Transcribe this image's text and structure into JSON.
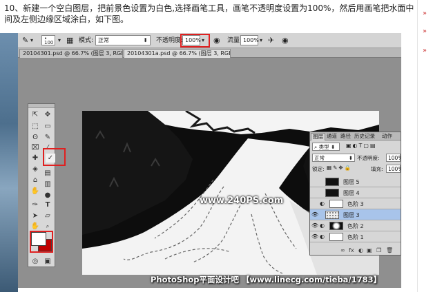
{
  "instruction": "10、新建一个空白图层，把前景色设置为白色,选择画笔工具，画笔不透明度设置为100%，然后用画笔把水面中间及左侧边缘区域涂白，如下图。",
  "colors": {
    "accent": "#e02020",
    "foreground": "#ffffff",
    "background": "#c00000",
    "selected_layer": "#a8c4ea"
  },
  "options_bar": {
    "brush_size": "100",
    "mode_label": "模式:",
    "mode_value": "正常",
    "opacity_label": "不透明度:",
    "opacity_value": "100%",
    "flow_label": "流量:",
    "flow_value": "100%"
  },
  "tabs": [
    {
      "label": "20104301.psd @ 66.7% (图层 3, RGB/8) *",
      "close": "×"
    },
    {
      "label": "20104301a.psd @ 66.7% (图层 3, RGB/8) *",
      "close": "×"
    }
  ],
  "toolbox": {
    "tools": [
      "move",
      "marquee",
      "lasso",
      "quick-select",
      "crop",
      "eyedropper",
      "healing",
      "brush",
      "clone-stamp",
      "history-brush",
      "eraser",
      "gradient",
      "blur",
      "dodge",
      "pen",
      "type",
      "path-select",
      "shape",
      "hand",
      "zoom"
    ],
    "glyphs": [
      "⇱",
      "✥",
      "⬚",
      "▭",
      "ʘ",
      "✎",
      "⌧",
      "⁄",
      "✚",
      "✓",
      "◈",
      "▤",
      "⌂",
      "▥",
      "✋",
      "●",
      "✑",
      "T",
      "➤",
      "▱",
      "✋",
      "🔍"
    ]
  },
  "layers_panel": {
    "tabs": [
      "图层",
      "通道",
      "路径",
      "历史记录",
      "动作"
    ],
    "filter_label": "类型",
    "blend_mode": "正常",
    "opacity_label": "不透明度:",
    "opacity_value": "100%",
    "lock_label": "锁定:",
    "fill_label": "填充:",
    "fill_value": "100%",
    "layers": [
      {
        "name": "图层 5",
        "visible": false,
        "thumb": "dark"
      },
      {
        "name": "图层 4",
        "visible": false,
        "thumb": "dark"
      },
      {
        "name": "色阶 3",
        "visible": false,
        "thumb": "white",
        "adjustment": true
      },
      {
        "name": "图层 3",
        "visible": true,
        "thumb": "dots",
        "selected": true
      },
      {
        "name": "色阶 2",
        "visible": true,
        "thumb": "dark",
        "adjustment": true
      },
      {
        "name": "色阶 1",
        "visible": true,
        "thumb": "white",
        "adjustment": true
      }
    ],
    "bottom_icons": [
      "fx",
      "◐",
      "▣",
      "❐",
      "🗑"
    ]
  },
  "watermark": "www.240PS.com",
  "footer": "PhotoShop平面设计吧 【www.linecg.com/tieba/1783】"
}
